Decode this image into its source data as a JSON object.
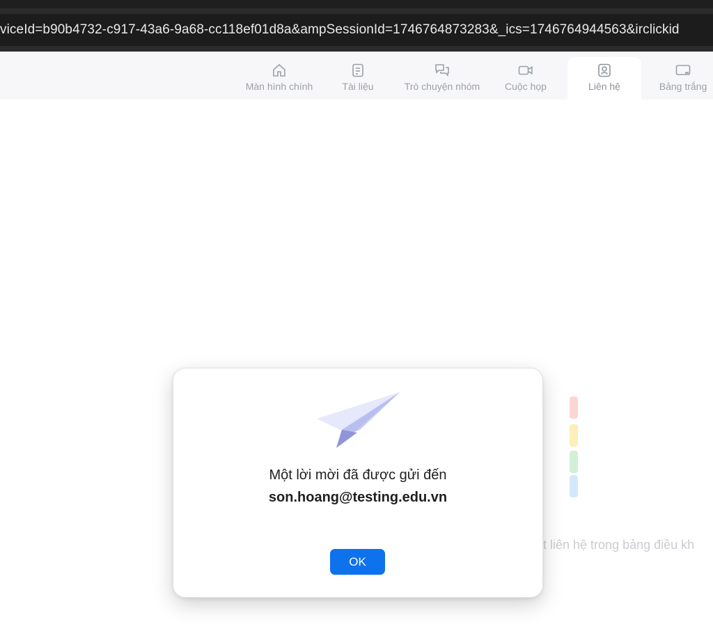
{
  "browser": {
    "url_fragment": "viceId=b90b4732-c917-43a6-9a68-cc118ef01d8a&ampSessionId=1746764873283&_ics=1746764944563&irclickid"
  },
  "nav": {
    "tabs": [
      {
        "label": "Màn hình chính",
        "icon": "home-icon"
      },
      {
        "label": "Tài liệu",
        "icon": "document-icon"
      },
      {
        "label": "Trò chuyện nhóm",
        "icon": "chat-icon"
      },
      {
        "label": "Cuộc họp",
        "icon": "video-camera-icon"
      },
      {
        "label": "Liên hệ",
        "icon": "contact-icon",
        "active": true
      },
      {
        "label": "Bảng trắng",
        "icon": "whiteboard-icon"
      }
    ]
  },
  "background": {
    "hint_text": "ột liên hệ trong bảng điều kh",
    "accent_colors": [
      "#fcd6d3",
      "#fcefb8",
      "#d2f0d6",
      "#d3e9fb"
    ]
  },
  "dialog": {
    "message": "Một lời mời đã được gửi đến",
    "email": "son.hoang@testing.edu.vn",
    "ok_label": "OK",
    "ok_color": "#0e72ed"
  }
}
